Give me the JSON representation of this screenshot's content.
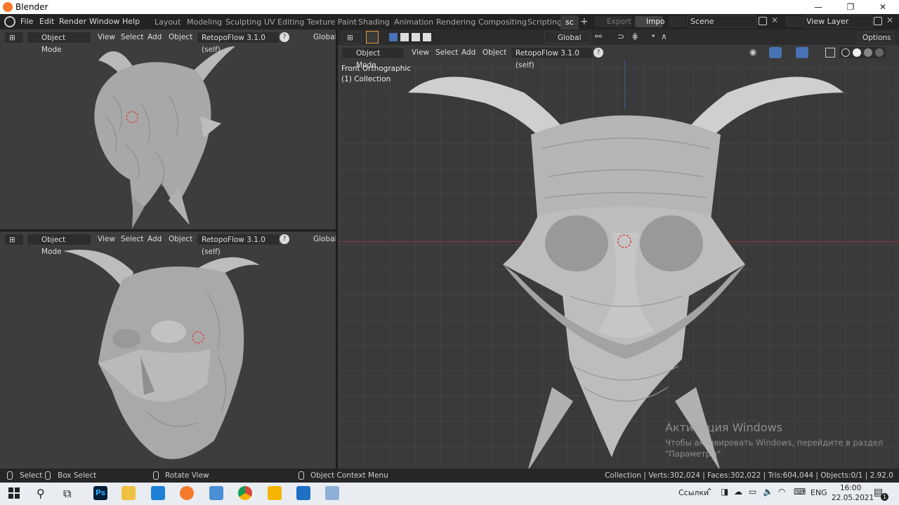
{
  "window": {
    "title": "Blender",
    "controls": [
      "—",
      "❐",
      "✕"
    ]
  },
  "menu": {
    "items": [
      "File",
      "Edit",
      "Render",
      "Window",
      "Help"
    ]
  },
  "workspaces": {
    "tabs": [
      "Layout",
      "Modeling",
      "Sculpting",
      "UV Editing",
      "Texture Paint",
      "Shading",
      "Animation",
      "Rendering",
      "Compositing",
      "Scripting",
      "sc"
    ],
    "active": "sc",
    "add": "+"
  },
  "topright": {
    "export": "Export",
    "import": "Impo",
    "scene": "Scene",
    "view_layer": "View Layer"
  },
  "viewport_small": {
    "mode": "Object Mode",
    "view": "View",
    "select": "Select",
    "add": "Add",
    "object": "Object",
    "addon": "RetopoFlow 3.1.0 (self)",
    "orientation": "Global",
    "help": "?"
  },
  "viewport_main": {
    "mode": "Object Mode",
    "view": "View",
    "select": "Select",
    "add": "Add",
    "object": "Object",
    "addon": "RetopoFlow 3.1.0 (self)",
    "orientation": "Global",
    "options": "Options",
    "view_name": "Front Orthographic",
    "collection": "(1) Collection",
    "help": "?"
  },
  "watermark": {
    "line1": "Активация Windows",
    "line2": "Чтобы активировать Windows, перейдите в раздел",
    "line3": "\"Параметры\"."
  },
  "statusbar": {
    "select": "Select",
    "box_select": "Box Select",
    "rotate": "Rotate View",
    "context_menu": "Object Context Menu",
    "stats": "Collection | Verts:302,024 | Faces:302,022 | Tris:604,044 | Objects:0/1 | 2.92.0"
  },
  "taskbar": {
    "links": "Ссылки",
    "lang": "ENG",
    "time": "16:00",
    "date": "22.05.2021",
    "notif": "1"
  },
  "colors": {
    "accent": "#4772b3",
    "blender_orange": "#f5792a",
    "viewport_bg": "#3d3d3d"
  }
}
